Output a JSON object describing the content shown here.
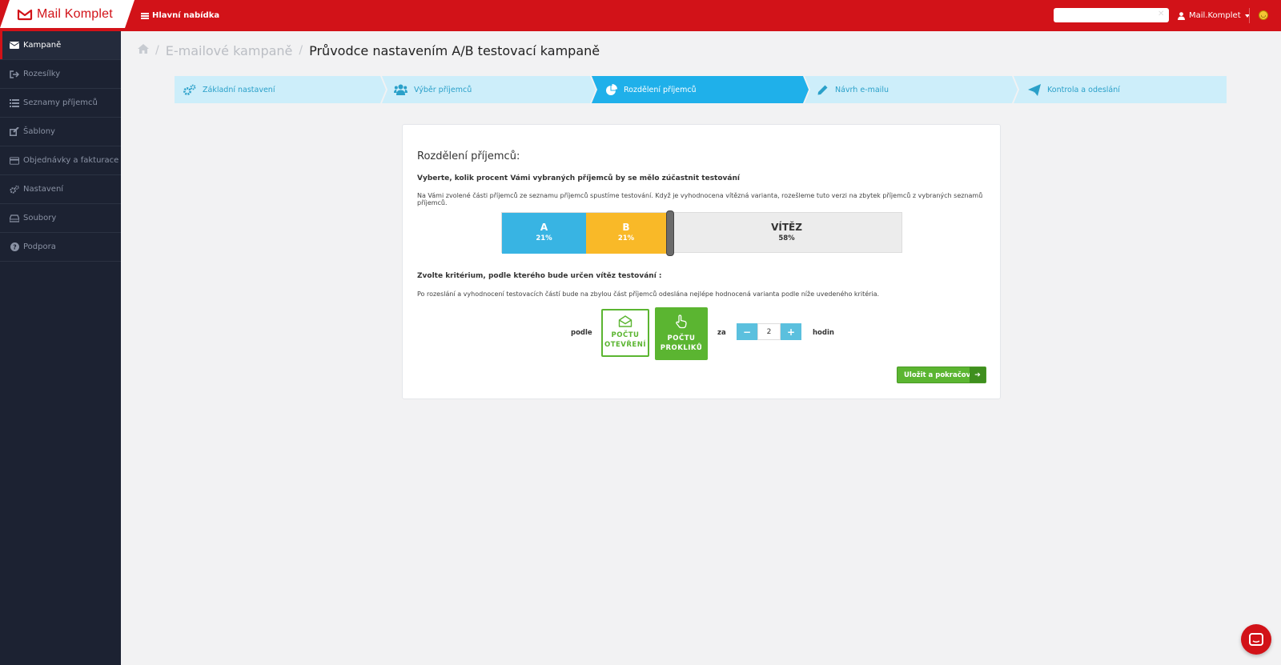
{
  "header": {
    "logo_text": "Mail Komplet",
    "menu_label": "Hlavní nabídka",
    "search_placeholder": "",
    "user_name": "Mail.Komplet",
    "brand_color": "#d21218"
  },
  "sidebar": {
    "items": [
      {
        "label": "Kampaně",
        "icon": "envelope-icon",
        "active": true
      },
      {
        "label": "Rozesílky",
        "icon": "sign-out-icon",
        "active": false
      },
      {
        "label": "Seznamy příjemců",
        "icon": "list-icon",
        "active": false
      },
      {
        "label": "Šablony",
        "icon": "edit-icon",
        "active": false
      },
      {
        "label": "Objednávky a fakturace",
        "icon": "credit-card-icon",
        "active": false
      },
      {
        "label": "Nastavení",
        "icon": "gears-icon",
        "active": false
      },
      {
        "label": "Soubory",
        "icon": "hdd-icon",
        "active": false
      },
      {
        "label": "Podpora",
        "icon": "question-circle-icon",
        "active": false
      }
    ]
  },
  "breadcrumb": {
    "prev": "E-mailové kampaně",
    "current": "Průvodce nastavením A/B testovací kampaně"
  },
  "wizard": {
    "steps": [
      {
        "label": "Základní nastavení",
        "icon": "gears-icon",
        "active": false
      },
      {
        "label": "Výběr příjemců",
        "icon": "users-icon",
        "active": false
      },
      {
        "label": "Rozdělení příjemců",
        "icon": "pie-chart-icon",
        "active": true
      },
      {
        "label": "Návrh e-mailu",
        "icon": "pencil-icon",
        "active": false
      },
      {
        "label": "Kontrola a odeslání",
        "icon": "paper-plane-icon",
        "active": false
      }
    ],
    "inactive_color": "#cdeefa",
    "active_color": "#1fb0ea"
  },
  "card": {
    "title": "Rozdělení příjemců:",
    "question1": "Vyberte, kolik procent Vámi vybraných příjemců by se mělo zúčastnit testování",
    "desc1": "Na Vámi zvolené části příjemců ze seznamu příjemců spustíme testování. Když je vyhodnocena vítězná varianta, rozešleme tuto verzi na zbytek příjemců z vybraných seznamů příjemců.",
    "split": {
      "a_label": "A",
      "a_percent": "21%",
      "a_color": "#38b4e3",
      "b_label": "B",
      "b_percent": "21%",
      "b_color": "#f9b928",
      "w_label": "VÍTĚZ",
      "w_percent": "58%"
    },
    "question2": "Zvolte kritérium, podle kterého bude určen vítěz testování :",
    "desc2": "Po rozeslání a vyhodnocení testovacích částí bude na zbylou část příjemců odeslána nejlépe hodnocená varianta podle níže uvedeného kritéria.",
    "podle": "podle",
    "option_open": {
      "line1": "POČTU",
      "line2": "OTEVŘENÍ",
      "selected": false
    },
    "option_click": {
      "line1": "POČTU",
      "line2": "PROKLIKŮ",
      "selected": true
    },
    "za": "za",
    "hours_value": "2",
    "minus": "−",
    "plus": "+",
    "hodin": "hodin",
    "save_label": "Uložit a pokračovat",
    "accent_green": "#5bb531"
  }
}
